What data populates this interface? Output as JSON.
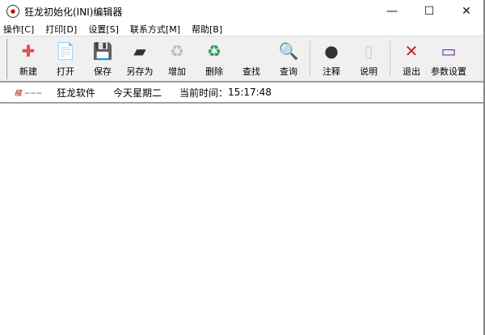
{
  "window": {
    "title": "狂龙初始化(INI)编辑器",
    "minimize": "—",
    "maximize": "☐",
    "close": "✕"
  },
  "menu": [
    "操作[C]",
    "打印[D]",
    "设置[S]",
    "联系方式[M]",
    "帮助[B]"
  ],
  "toolbar": [
    {
      "label": "新建",
      "icon": "new-icon",
      "glyph": "✚",
      "color": "#d9534f"
    },
    {
      "label": "打开",
      "icon": "open-icon",
      "glyph": "📄",
      "color": "#5a8fd8"
    },
    {
      "label": "保存",
      "icon": "save-icon",
      "glyph": "💾",
      "color": "#5566aa"
    },
    {
      "label": "另存为",
      "icon": "save-as-icon",
      "glyph": "▰",
      "color": "#333"
    },
    {
      "label": "增加",
      "icon": "add-icon",
      "glyph": "♻",
      "color": "#bbb"
    },
    {
      "label": "删除",
      "icon": "delete-icon",
      "glyph": "♻",
      "color": "#2a9d5a"
    },
    {
      "label": "查找",
      "icon": "find-icon",
      "glyph": "",
      "color": "#f0f0f0"
    },
    {
      "label": "查询",
      "icon": "query-icon",
      "glyph": "🔍",
      "color": "#e0a020"
    },
    {
      "label": "注释",
      "icon": "comment-icon",
      "glyph": "●",
      "color": "#333"
    },
    {
      "label": "说明",
      "icon": "info-icon",
      "glyph": "▯",
      "color": "#ccc"
    },
    {
      "label": "退出",
      "icon": "exit-icon",
      "glyph": "✕",
      "color": "#d02020"
    },
    {
      "label": "参数设置",
      "icon": "settings-monitor-icon",
      "glyph": "▭",
      "color": "#7030a0"
    }
  ],
  "status": {
    "logo": "狂龙软件",
    "company": "狂龙软件",
    "weekday": "今天星期二",
    "time_label": "当前时间：",
    "time": "15:17:48"
  }
}
